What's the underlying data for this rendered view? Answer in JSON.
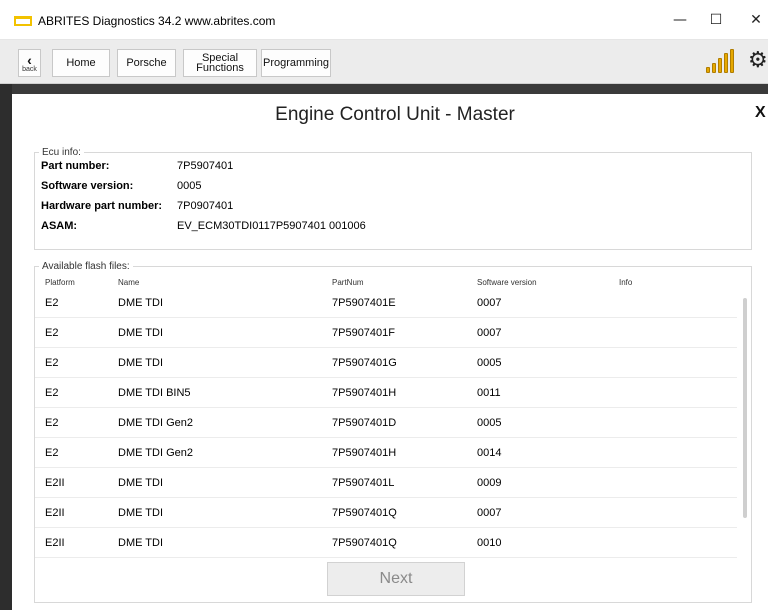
{
  "window": {
    "title": "ABRITES Diagnostics 34.2  www.abrites.com",
    "minimize": "—",
    "maximize": "☐",
    "close": "✕"
  },
  "toolbar": {
    "back_arrow": "‹",
    "back_label": "back",
    "home": "Home",
    "porsche": "Porsche",
    "special_line1": "Special",
    "special_line2": "Functions",
    "programming": "Programming",
    "settings_icon": "⚙"
  },
  "panel": {
    "title": "Engine Control Unit - Master",
    "close": "X"
  },
  "ecu_info": {
    "legend": "Ecu info:",
    "fields": [
      {
        "label": "Part number:",
        "value": "7P5907401"
      },
      {
        "label": "Software version:",
        "value": "0005"
      },
      {
        "label": "Hardware part number:",
        "value": "7P0907401"
      },
      {
        "label": "ASAM:",
        "value": "EV_ECM30TDI0117P5907401 001006"
      }
    ]
  },
  "flash_files": {
    "legend": "Available flash files:",
    "columns": [
      "Platform",
      "Name",
      "PartNum",
      "Software version",
      "Info"
    ],
    "rows": [
      {
        "platform": "E2",
        "name": "DME TDI",
        "partnum": "7P5907401E",
        "swver": "0007",
        "info": ""
      },
      {
        "platform": "E2",
        "name": "DME TDI",
        "partnum": "7P5907401F",
        "swver": "0007",
        "info": ""
      },
      {
        "platform": "E2",
        "name": "DME TDI",
        "partnum": "7P5907401G",
        "swver": "0005",
        "info": ""
      },
      {
        "platform": "E2",
        "name": "DME TDI BIN5",
        "partnum": "7P5907401H",
        "swver": "0011",
        "info": ""
      },
      {
        "platform": "E2",
        "name": "DME TDI Gen2",
        "partnum": "7P5907401D",
        "swver": "0005",
        "info": ""
      },
      {
        "platform": "E2",
        "name": "DME TDI Gen2",
        "partnum": "7P5907401H",
        "swver": "0014",
        "info": ""
      },
      {
        "platform": "E2II",
        "name": "DME TDI",
        "partnum": "7P5907401L",
        "swver": "0009",
        "info": ""
      },
      {
        "platform": "E2II",
        "name": "DME TDI",
        "partnum": "7P5907401Q",
        "swver": "0007",
        "info": ""
      },
      {
        "platform": "E2II",
        "name": "DME TDI",
        "partnum": "7P5907401Q",
        "swver": "0010",
        "info": ""
      }
    ]
  },
  "next_button": "Next",
  "colors": {
    "accent": "#f2c200",
    "signal": "#e6a800",
    "dark_border": "#2d2d2d"
  }
}
